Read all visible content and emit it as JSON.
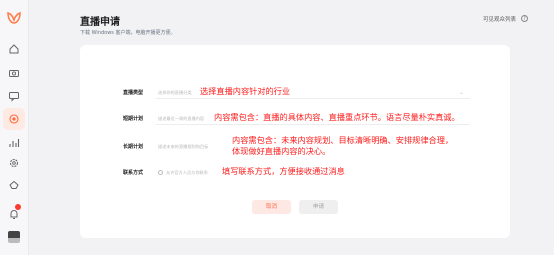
{
  "header": {
    "title": "直播申请",
    "subtitle": "下载 Windows 客户端，电脑开播更方便。",
    "audience_link": "可见观众列表",
    "help_glyph": "?"
  },
  "form": {
    "category": {
      "label": "直播类型",
      "placeholder": "选择你的直播分类",
      "note": "选择直播内容针对的行业"
    },
    "short_plan": {
      "label": "短期计划",
      "placeholder": "描述最近一周的直播内容",
      "note": "内容需包含：直播的具体内容、直播重点环节。语言尽量朴实真诚。"
    },
    "long_plan": {
      "label": "长期计划",
      "placeholder": "描述未来的直播规划和目标",
      "note_line1": "内容需包含：未来内容规划、目标清晰明确、安排规律合理，",
      "note_line2": "体现做好直播内容的决心。"
    },
    "contact": {
      "label": "联系方式",
      "option": "允许官方人员与你联系",
      "note": "填写联系方式，方便接收通过消息"
    }
  },
  "buttons": {
    "cancel": "取消",
    "apply": "申请"
  },
  "colors": {
    "accent": "#ff6a4d",
    "annotation": "#ff1a1a"
  },
  "icons": [
    "logo-icon",
    "home-icon",
    "camera-icon",
    "message-icon",
    "live-icon",
    "stats-icon",
    "settings-icon",
    "share-icon",
    "notification-icon",
    "avatar"
  ]
}
